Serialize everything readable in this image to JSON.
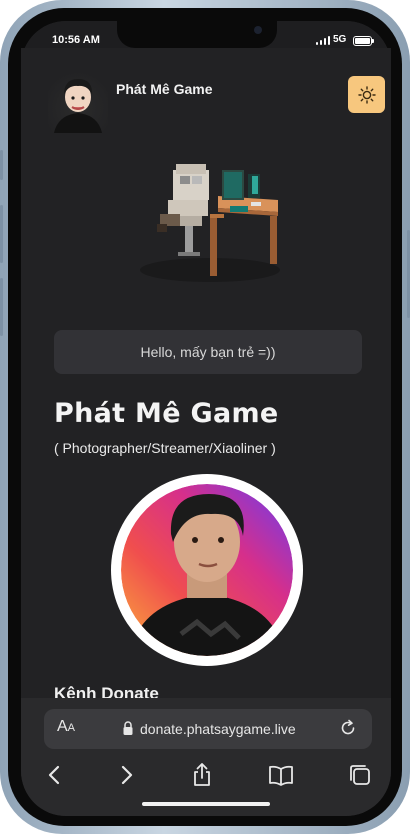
{
  "status_bar": {
    "time": "10:56 AM",
    "network": "5G"
  },
  "header": {
    "site_name": "Phát Mê Game"
  },
  "greeting": "Hello, mấy bạn trẻ =))",
  "profile": {
    "name": "Phát Mê Game",
    "subtitle": "( Photographer/Streamer/Xiaoliner )"
  },
  "sections": {
    "donate_title": "Kênh Donate"
  },
  "browser": {
    "aa_large": "A",
    "aa_small": "A",
    "url": "donate.phatsaygame.live"
  },
  "colors": {
    "background": "#222224",
    "accent": "#f7c77e",
    "card": "#323236"
  },
  "icons": [
    "sun-icon",
    "lock-icon",
    "reload-icon",
    "back-icon",
    "forward-icon",
    "share-icon",
    "bookmarks-icon",
    "tabs-icon"
  ]
}
